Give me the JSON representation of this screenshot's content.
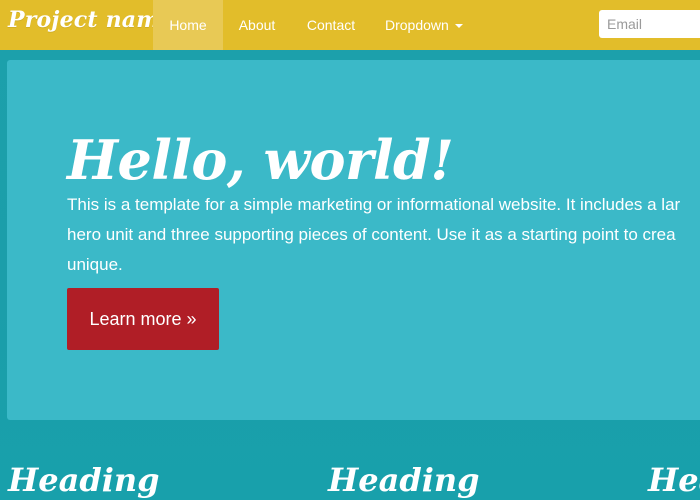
{
  "navbar": {
    "brand": "Project name",
    "items": [
      {
        "label": "Home",
        "active": true
      },
      {
        "label": "About",
        "active": false
      },
      {
        "label": "Contact",
        "active": false
      },
      {
        "label": "Dropdown",
        "active": false,
        "has_caret": true
      }
    ],
    "email_placeholder": "Email"
  },
  "hero": {
    "title": "Hello, world!",
    "text_lines": [
      "This is a template for a simple marketing or informational website. It includes a lar",
      "hero unit and three supporting pieces of content. Use it as a starting point to crea",
      "unique."
    ],
    "button_label": "Learn more »"
  },
  "columns": [
    {
      "heading": "Heading"
    },
    {
      "heading": "Heading"
    },
    {
      "heading": "Heading"
    }
  ],
  "colors": {
    "navbar": "#e2bd2a",
    "nav_active": "#e8c955",
    "hero": "#3bb9c8",
    "background": "#1ea0ab",
    "button": "#b01e26",
    "text": "#ffffff"
  }
}
